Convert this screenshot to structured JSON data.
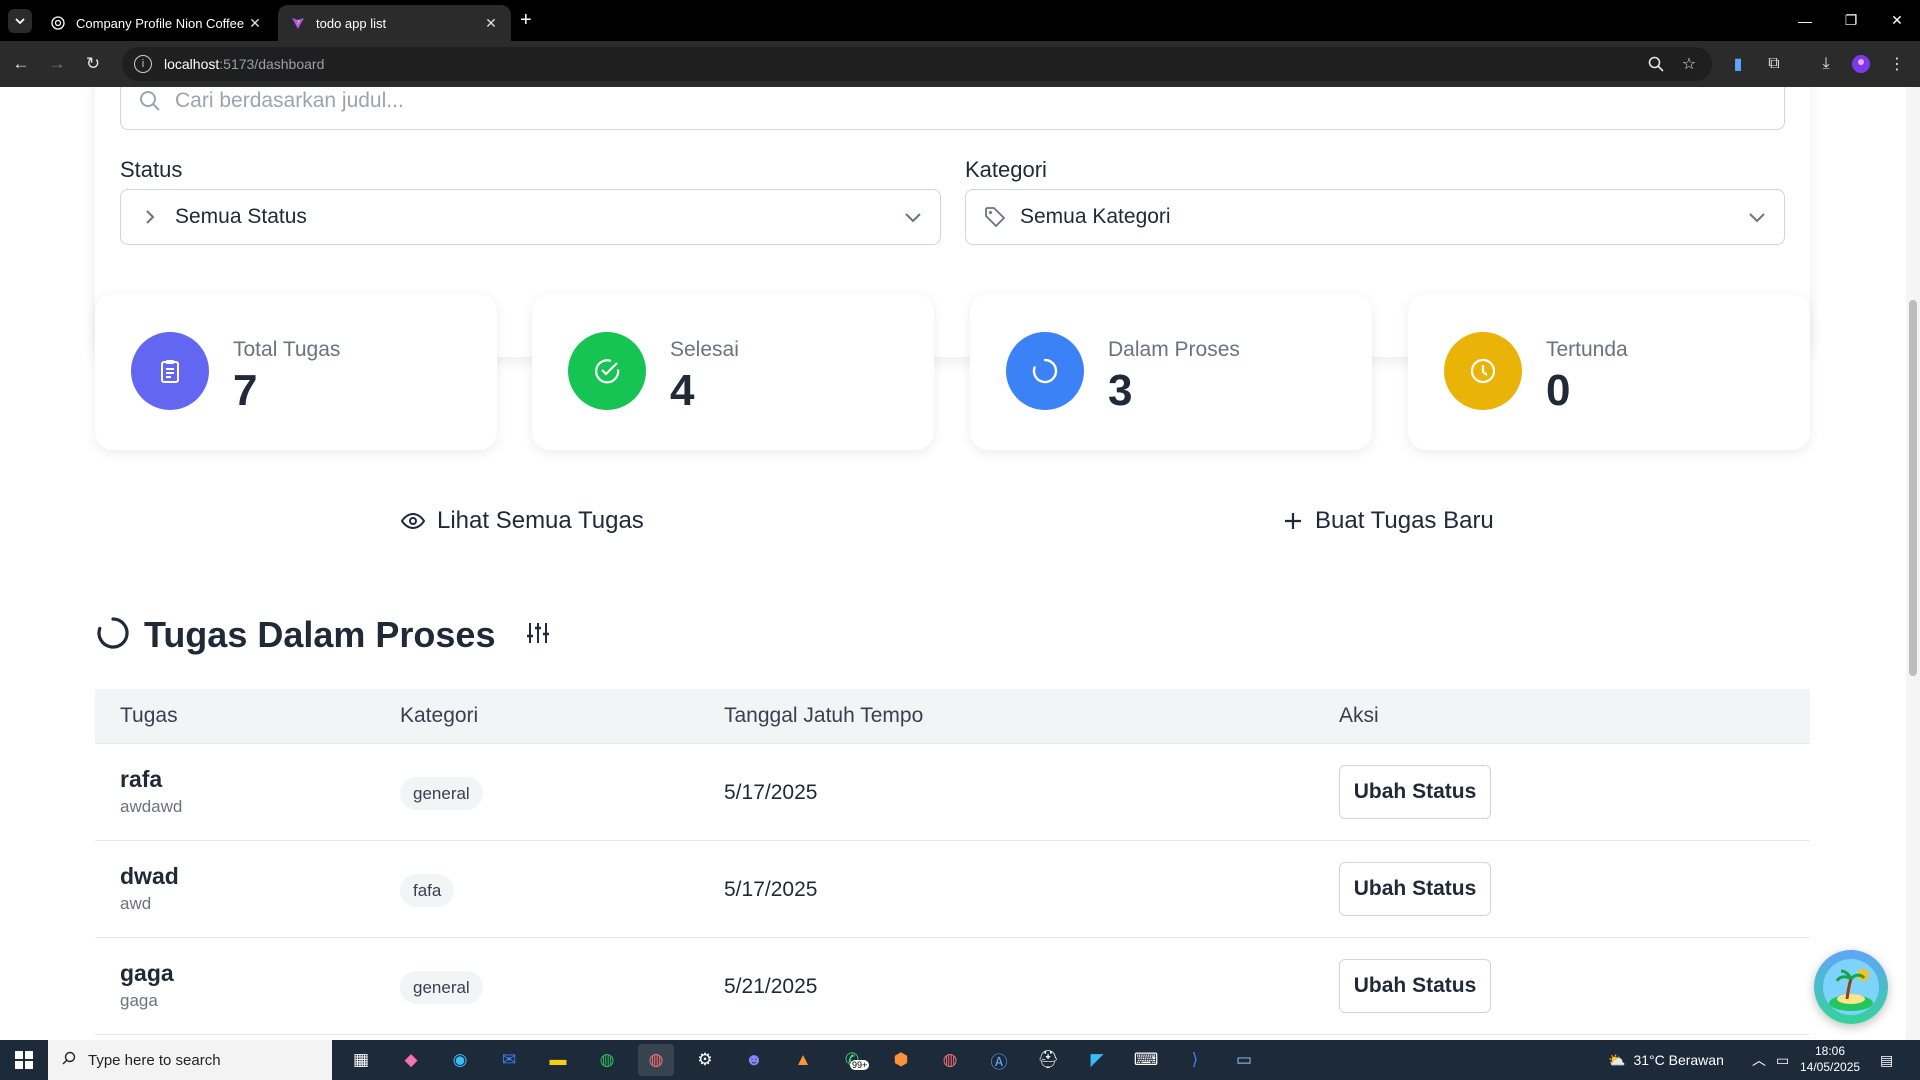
{
  "browser": {
    "tabs": [
      {
        "title": "Company Profile Nion Coffee",
        "icon": "globe-icon"
      },
      {
        "title": "todo app list",
        "icon": "vite-icon"
      }
    ],
    "url_host": "localhost",
    "url_path": ":5173/dashboard"
  },
  "filters": {
    "search_placeholder": "Cari berdasarkan judul...",
    "status_label": "Status",
    "status_value": "Semua Status",
    "category_label": "Kategori",
    "category_value": "Semua Kategori"
  },
  "stats": [
    {
      "label": "Total Tugas",
      "value": "7",
      "color": "#6366f1",
      "icon": "clipboard-icon"
    },
    {
      "label": "Selesai",
      "value": "4",
      "color": "#16c453",
      "icon": "check-circle-icon"
    },
    {
      "label": "Dalam Proses",
      "value": "3",
      "color": "#3b82f6",
      "icon": "spinner-icon"
    },
    {
      "label": "Tertunda",
      "value": "0",
      "color": "#eab308",
      "icon": "clock-icon"
    }
  ],
  "actions": {
    "view_all": "Lihat Semua Tugas",
    "create_new": "Buat Tugas Baru"
  },
  "section": {
    "title": "Tugas Dalam Proses"
  },
  "table": {
    "headers": [
      "Tugas",
      "Kategori",
      "Tanggal Jatuh Tempo",
      "Aksi"
    ],
    "rows": [
      {
        "name": "rafa",
        "desc": "awdawd",
        "category": "general",
        "date": "5/17/2025",
        "action": "Ubah Status"
      },
      {
        "name": "dwad",
        "desc": "awd",
        "category": "fafa",
        "date": "5/17/2025",
        "action": "Ubah Status"
      },
      {
        "name": "gaga",
        "desc": "gaga",
        "category": "general",
        "date": "5/21/2025",
        "action": "Ubah Status"
      }
    ]
  },
  "taskbar": {
    "search_placeholder": "Type here to search",
    "weather": "31°C  Berawan",
    "time": "18:06",
    "date": "14/05/2025",
    "whatsapp_badge": "99+"
  }
}
